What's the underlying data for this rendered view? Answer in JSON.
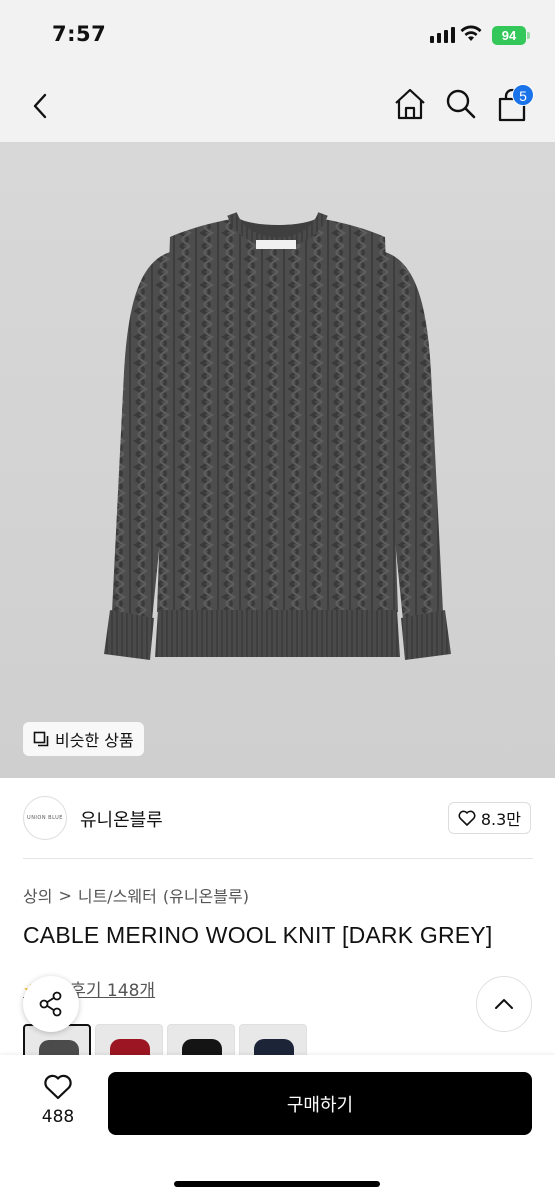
{
  "status_bar": {
    "time": "7:57",
    "battery": "94"
  },
  "nav": {
    "back_icon": "chevron-left-icon",
    "home_icon": "home-icon",
    "search_icon": "search-icon",
    "bag_icon": "shopping-bag-icon",
    "bag_badge": "5"
  },
  "hero": {
    "similar_label": "비슷한 상품"
  },
  "brand": {
    "logo_text": "UNION BLUE",
    "name": "유니온블루",
    "like_count": "8.3만"
  },
  "breadcrumb": {
    "level1": "상의",
    "separator": ">",
    "level2": "니트/스웨터",
    "brand": "(유니온블루)"
  },
  "product": {
    "title": "CABLE MERINO WOOL KNIT [DARK GREY]",
    "review_text": "후기 148개"
  },
  "swatches": [
    {
      "name": "dark-grey",
      "color": "#4b4b4b"
    },
    {
      "name": "red",
      "color": "#9c1522"
    },
    {
      "name": "black",
      "color": "#141414"
    },
    {
      "name": "navy",
      "color": "#1c2438"
    }
  ],
  "bottom": {
    "wish_count": "488",
    "buy_label": "구매하기"
  },
  "colors": {
    "badge": "#1a73e8",
    "battery": "#34c759",
    "buy_button": "#000000"
  }
}
